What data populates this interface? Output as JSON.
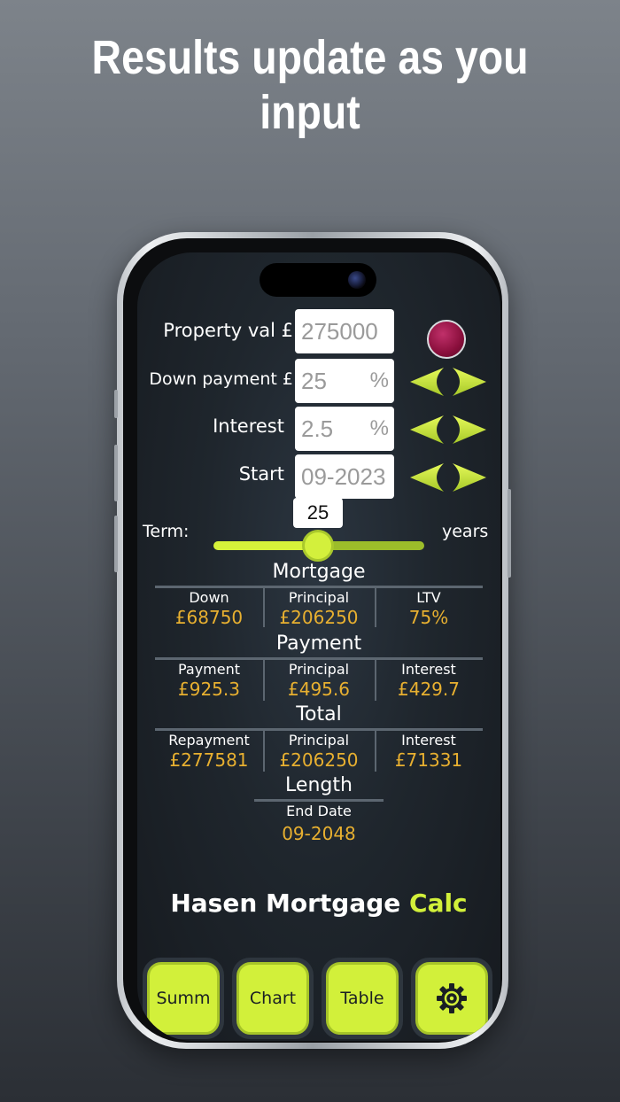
{
  "headline": "Results update as you input",
  "form": {
    "property_label": "Property val £",
    "property_value": "275000",
    "down_label": "Down payment £",
    "down_value": "25",
    "down_unit": "%",
    "interest_label": "Interest",
    "interest_value": "2.5",
    "interest_unit": "%",
    "start_label": "Start",
    "start_value": "09-2023"
  },
  "term": {
    "label": "Term:",
    "value": "25",
    "unit": "years",
    "slider_fraction": 0.5
  },
  "mortgage": {
    "title": "Mortgage",
    "cells": [
      {
        "label": "Down",
        "value": "£68750"
      },
      {
        "label": "Principal",
        "value": "£206250"
      },
      {
        "label": "LTV",
        "value": "75%"
      }
    ]
  },
  "payment": {
    "title": "Payment",
    "cells": [
      {
        "label": "Payment",
        "value": "£925.3"
      },
      {
        "label": "Principal",
        "value": "£495.6"
      },
      {
        "label": "Interest",
        "value": "£429.7"
      }
    ]
  },
  "total": {
    "title": "Total",
    "cells": [
      {
        "label": "Repayment",
        "value": "£277581"
      },
      {
        "label": "Principal",
        "value": "£206250"
      },
      {
        "label": "Interest",
        "value": "£71331"
      }
    ]
  },
  "length": {
    "title": "Length",
    "label": "End Date",
    "value": "09-2048"
  },
  "brand": {
    "name": "Hasen Mortgage",
    "accent": "Calc"
  },
  "tabs": [
    {
      "label": "Summ"
    },
    {
      "label": "Chart"
    },
    {
      "label": "Table"
    },
    {
      "icon": "gear-icon"
    }
  ],
  "colors": {
    "accent": "#d2f03a",
    "value": "#e8b030",
    "reset": "#8a0f3c"
  }
}
